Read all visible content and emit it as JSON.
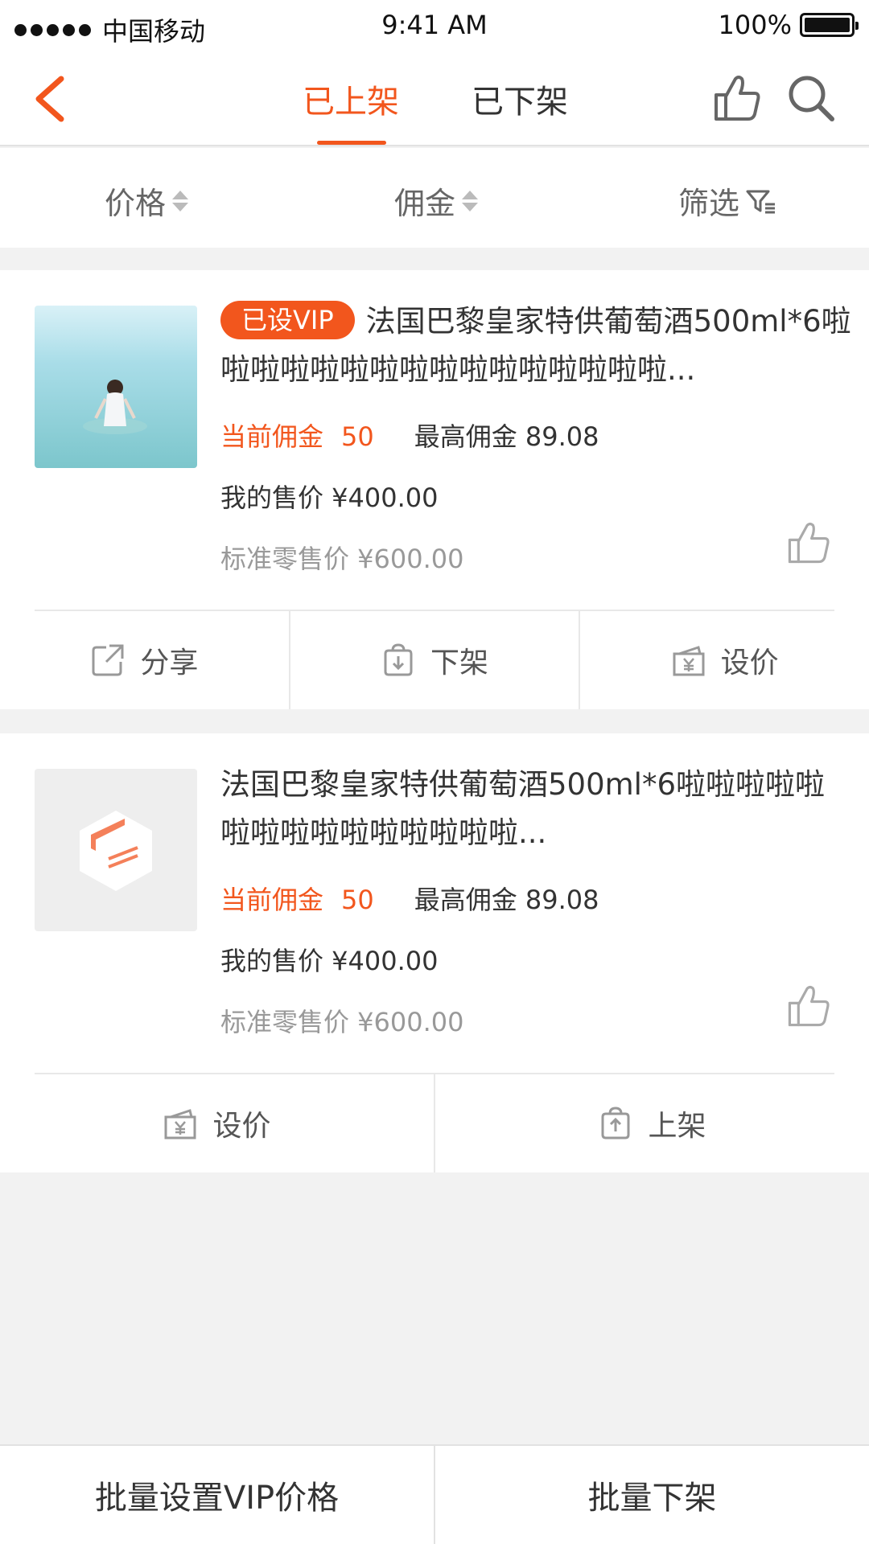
{
  "status_bar": {
    "carrier": "中国移动",
    "time": "9:41 AM",
    "battery": "100%"
  },
  "nav": {
    "tabs": [
      {
        "label": "已上架",
        "active": true
      },
      {
        "label": "已下架",
        "active": false
      }
    ],
    "icons": [
      "back-arrow-icon",
      "thumbs-up-icon",
      "search-icon"
    ]
  },
  "sort": {
    "price_label": "价格",
    "commission_label": "佣金",
    "filter_label": "筛选"
  },
  "products": [
    {
      "badge": "已设VIP",
      "title": "法国巴黎皇家特供葡萄酒500ml*6啦啦啦啦啦啦啦啦啦啦啦啦啦啦啦啦...",
      "current_commission_label": "当前佣金",
      "current_commission_value": "50",
      "max_commission": "最高佣金 89.08",
      "my_price": "我的售价 ¥400.00",
      "standard_price": "标准零售价 ¥600.00",
      "actions": [
        "分享",
        "下架",
        "设价"
      ]
    },
    {
      "badge": "",
      "title": "法国巴黎皇家特供葡萄酒500ml*6啦啦啦啦啦啦啦啦啦啦啦啦啦啦啦...",
      "current_commission_label": "当前佣金",
      "current_commission_value": "50",
      "max_commission": "最高佣金 89.08",
      "my_price": "我的售价 ¥400.00",
      "standard_price": "标准零售价 ¥600.00",
      "actions": [
        "设价",
        "上架"
      ]
    }
  ],
  "bottom_bar": {
    "batch_vip_label": "批量设置VIP价格",
    "batch_offshelf_label": "批量下架"
  },
  "colors": {
    "accent": "#f2561d",
    "background": "#f2f2f2",
    "text": "#333333",
    "muted": "#999999"
  }
}
